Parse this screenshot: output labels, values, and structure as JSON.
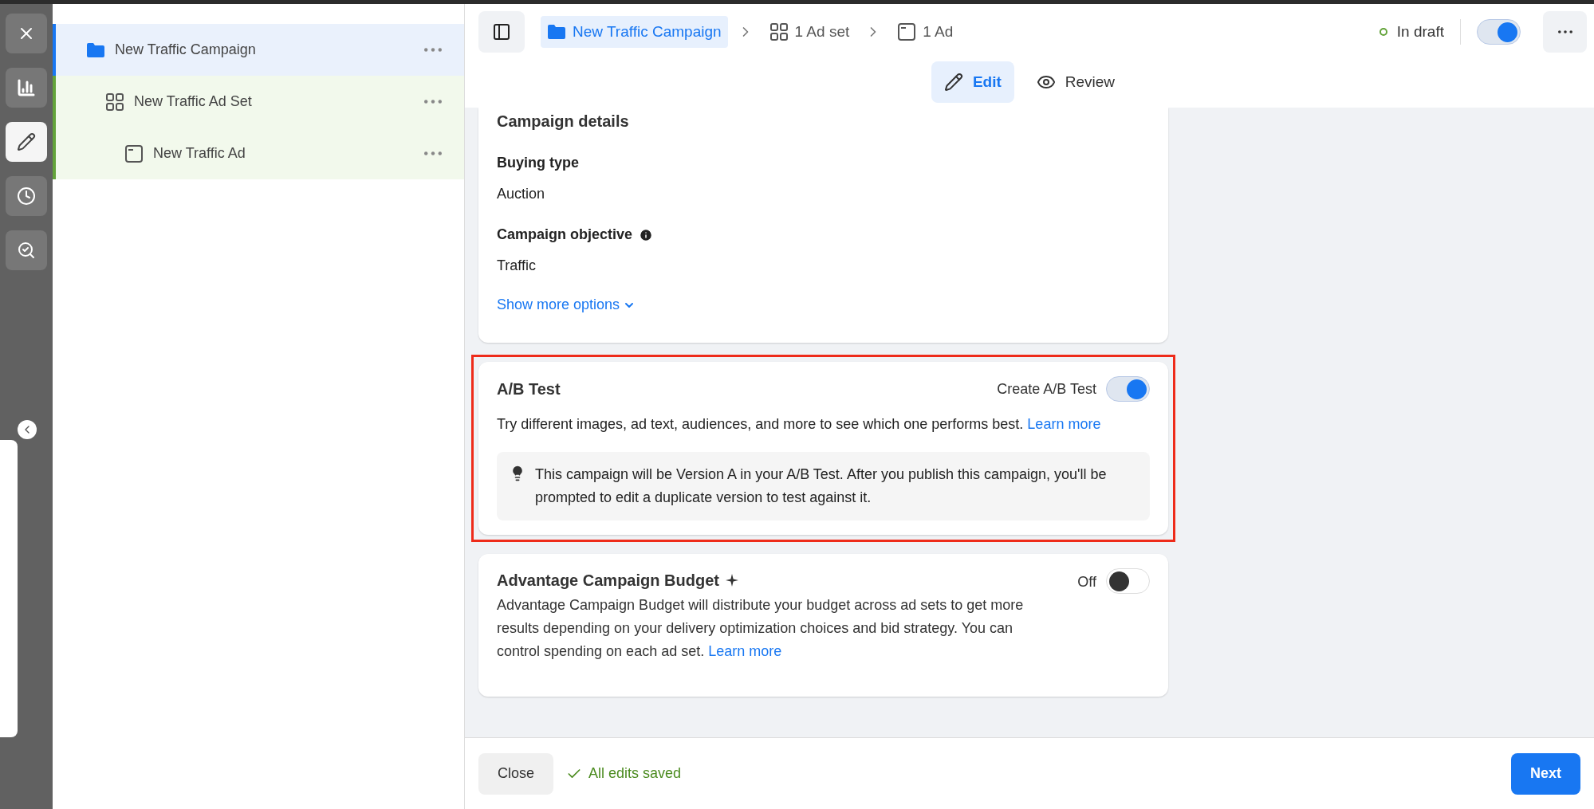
{
  "rail": {
    "items": [
      {
        "kind": "close",
        "selected": false
      },
      {
        "kind": "chart",
        "selected": false
      },
      {
        "kind": "edit",
        "selected": true
      },
      {
        "kind": "history",
        "selected": false
      },
      {
        "kind": "inspect",
        "selected": false
      }
    ]
  },
  "tree": [
    {
      "kind": "campaign",
      "label": "New Traffic Campaign",
      "selected": true,
      "children": [
        {
          "kind": "adset",
          "label": "New Traffic Ad Set",
          "selected": false,
          "children": [
            {
              "kind": "ad",
              "label": "New Traffic Ad",
              "selected": false
            }
          ]
        }
      ]
    }
  ],
  "breadcrumb": [
    {
      "kind": "campaign",
      "label": "New Traffic Campaign",
      "selected": true
    },
    {
      "kind": "adset",
      "label": "1 Ad set",
      "selected": false
    },
    {
      "kind": "ad",
      "label": "1 Ad",
      "selected": false
    }
  ],
  "status": {
    "label": "In draft",
    "color": "#63a33a",
    "on": true
  },
  "modes": [
    {
      "kind": "edit",
      "label": "Edit",
      "selected": true
    },
    {
      "kind": "review",
      "label": "Review",
      "selected": false
    }
  ],
  "campaign_details": {
    "title": "Campaign details",
    "fields": [
      {
        "label": "Buying type",
        "value": "Auction",
        "info": false
      },
      {
        "label": "Campaign objective",
        "value": "Traffic",
        "info": true
      }
    ],
    "more_link": "Show more options"
  },
  "ab_test": {
    "title": "A/B Test",
    "highlighted": true,
    "toggle_label": "Create A/B Test",
    "on": true,
    "description": "Try different images, ad text, audiences, and more to see which one performs best.",
    "link": "Learn more",
    "tip": "This campaign will be Version A in your A/B Test. After you publish this campaign, you'll be prompted to edit a duplicate version to test against it."
  },
  "budget": {
    "title": "Advantage Campaign Budget",
    "highlighted": false,
    "toggle_label": "Off",
    "on": false,
    "description": "Advantage Campaign Budget will distribute your budget across ad sets to get more results depending on your delivery optimization choices and bid strategy. You can control spending on each ad set.",
    "link": "Learn more"
  },
  "footer": {
    "close": "Close",
    "saved": "All edits saved",
    "next": "Next"
  }
}
